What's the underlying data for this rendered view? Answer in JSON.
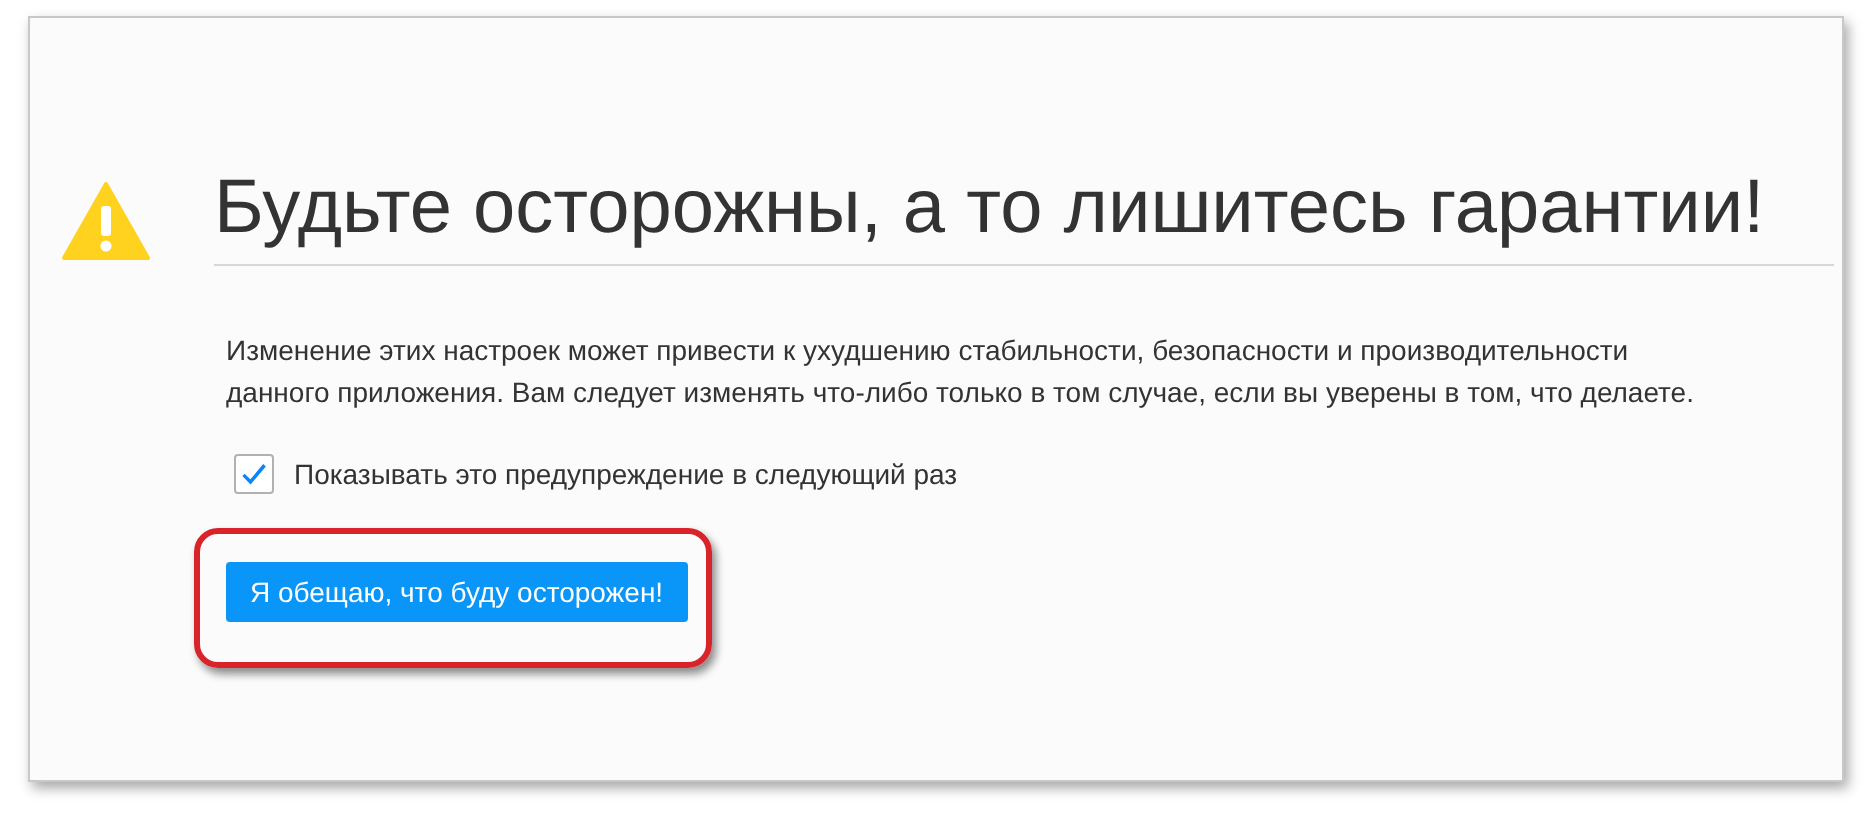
{
  "title": "Будьте осторожны, а то лишитесь гарантии!",
  "message": "Изменение этих настроек может привести к ухудшению стабильности, безопасности и производительности данного приложения. Вам следует изменять что-либо только в том случае, если вы уверены в том, что делаете.",
  "checkbox": {
    "label": "Показывать это предупреждение в следующий раз",
    "checked": true
  },
  "button": {
    "label": "Я обещаю, что буду осторожен!",
    "highlighted": true
  }
}
